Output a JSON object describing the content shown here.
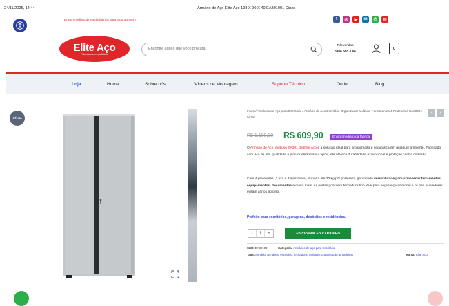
{
  "browser": {
    "datetime": "24/11/2025, 14:44",
    "page_title": "Armário de Aço Elite Aço 198 X 90 X 40 EA301001 Cinza"
  },
  "header": {
    "promo_text": "Envio Imediato direto da fábrica para todo o Brasil !",
    "logo_text": "Elite Aço",
    "logo_tagline": "Fabricado com qualidade",
    "search_placeholder": "Encontre aqui o que você procura",
    "phone_label": "Televendas",
    "phone_number": "0800 000 4 50",
    "cart_count": "0",
    "social_icons": [
      {
        "name": "facebook-icon",
        "color": "#3b5998",
        "glyph": "f"
      },
      {
        "name": "instagram-icon",
        "color": "#c13584",
        "glyph": "◎"
      },
      {
        "name": "youtube-icon",
        "color": "#e62117",
        "glyph": "▶"
      },
      {
        "name": "linkedin-icon",
        "color": "#0e76a8",
        "glyph": "in"
      },
      {
        "name": "whatsapp-icon",
        "color": "#2cae4a",
        "glyph": "✆"
      },
      {
        "name": "email-icon",
        "color": "#e0262a",
        "glyph": "✉"
      }
    ]
  },
  "nav": {
    "items": [
      {
        "label": "Loja"
      },
      {
        "label": "Home"
      },
      {
        "label": "Sobre nós"
      },
      {
        "label": "Vídeos de Montagem"
      },
      {
        "label": "Suporte Técnico"
      },
      {
        "label": "Outlet"
      },
      {
        "label": "Blog"
      }
    ]
  },
  "product": {
    "sale_badge": "Oferta",
    "breadcrumb": "Início / Armários de Aço para Escritório / Armário de Aço Escritório Organizador Multiuso Ferramentas 4 Prateleiras EA30001 Cinza",
    "old_price": "R$ 1.100,00",
    "new_price": "R$ 609,90",
    "shipping_badge": "Envio Imediato da fábrica",
    "desc1_pre": "O ",
    "desc1_link": "Armário de Aço Multiuso EA301 da Elite Aço",
    "desc1_post": " é a solução ideal para organização e segurança em qualquer ambiente. Fabricado com aço de alta qualidade e pintura eletrostática epóxi, ele oferece durabilidade excepcional e proteção contra corrosão.",
    "desc2_pre": "Com 4 prateleiras (1 fixa e 3 ajustáveis), suporta até 30 kg por prateleira, garantindo ",
    "desc2_bold": "versatilidade para armazenar ferramentas, equipamentos, documentos",
    "desc2_post": " e muito mais. As portas possuem fechadura tipo Yale para segurança adicional e os pés niveladores evitam danos ao piso.",
    "perfect_for": "Perfeito para escritórios, garagens, depósitos e residências.",
    "quantity": "1",
    "qty_minus": "-",
    "qty_plus": "+",
    "add_to_cart": "ADICIONAR AO CARRINHO",
    "sku_label": "SKU:",
    "sku_value": "EA30100",
    "category_label": "Categoria:",
    "category_value": "Armários de aço para Escritório",
    "tags_label": "Tags:",
    "tags_value": "armário, armários, escritório, fechadura, multiuso, organização, prateleiras",
    "brand_label": "Marca:",
    "brand_value": "Elite Aço"
  },
  "colors": {
    "brand_red": "#e0262a",
    "price_green": "#1b8a3a",
    "badge_purple": "#8b3fd6",
    "nav_active_blue": "#2f62d8"
  }
}
